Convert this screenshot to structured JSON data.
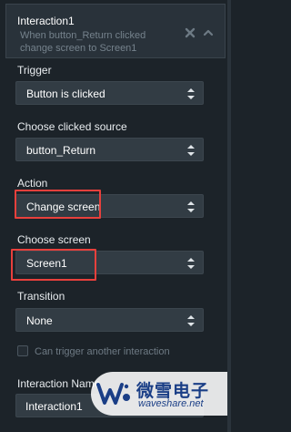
{
  "colors": {
    "background": "#1c2329",
    "header_bg": "#29323a",
    "field_bg": "#323c44",
    "highlight": "#e8403c",
    "muted_text": "#75828c",
    "watermark_text": "#1a3e86"
  },
  "header": {
    "title": "Interaction1",
    "description": "When button_Return clicked change screen to Screen1",
    "icons": [
      "close-icon",
      "chevron-up-icon"
    ]
  },
  "trigger": {
    "label": "Trigger",
    "value": "Button is clicked"
  },
  "source": {
    "label": "Choose clicked source",
    "value": "button_Return"
  },
  "action": {
    "label": "Action",
    "value": "Change screen",
    "highlighted": true
  },
  "screen": {
    "label": "Choose screen",
    "value": "Screen1",
    "highlighted": true
  },
  "transition": {
    "label": "Transition",
    "value": "None"
  },
  "chain": {
    "label": "Can trigger another interaction",
    "checked": false
  },
  "name": {
    "label": "Interaction Name",
    "value": "Interaction1"
  },
  "watermark": {
    "cn": "微雪电子",
    "en": "waveshare.net"
  }
}
